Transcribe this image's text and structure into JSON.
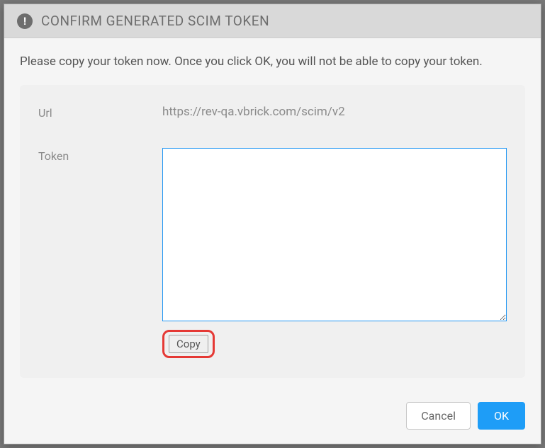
{
  "dialog": {
    "title": "CONFIRM GENERATED SCIM TOKEN",
    "intro": "Please copy your token now. Once you click OK, you will not be able to copy your token.",
    "url_label": "Url",
    "url_value": "https://rev-qa.vbrick.com/scim/v2",
    "token_label": "Token",
    "token_value": "",
    "copy_label": "Copy",
    "cancel_label": "Cancel",
    "ok_label": "OK"
  }
}
